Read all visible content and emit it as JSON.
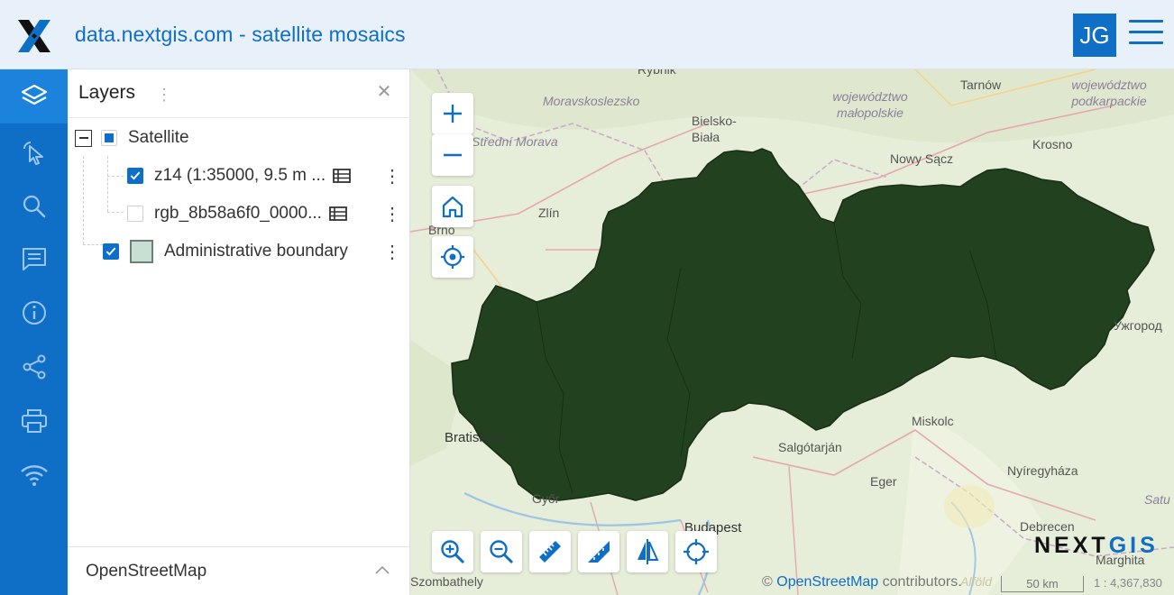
{
  "header": {
    "title": "data.nextgis.com - satellite mosaics",
    "avatar_initials": "JG"
  },
  "sidebar": {
    "items": [
      {
        "icon": "layers-icon",
        "active": true
      },
      {
        "icon": "identify-pointer-icon"
      },
      {
        "icon": "search-icon"
      },
      {
        "icon": "description-icon"
      },
      {
        "icon": "info-icon"
      },
      {
        "icon": "share-icon"
      },
      {
        "icon": "print-icon"
      },
      {
        "icon": "wifi-icon"
      }
    ]
  },
  "panel": {
    "title": "Layers",
    "tree": {
      "group": {
        "label": "Satellite",
        "state": "partial"
      },
      "children": [
        {
          "label": "z14 (1:35000, 9.5 m ...",
          "checked": true
        },
        {
          "label": "rgb_8b58a6f0_0000...",
          "checked": false
        }
      ],
      "admin": {
        "label": "Administrative boundary",
        "checked": true
      }
    },
    "basemap": {
      "label": "OpenStreetMap"
    }
  },
  "map": {
    "places": [
      {
        "name": "Rybnik",
        "kind": "city"
      },
      {
        "name": "Moravskoslezsko",
        "kind": "region"
      },
      {
        "name": "województwo małopolskie",
        "kind": "region"
      },
      {
        "name": "Tarnów",
        "kind": "city"
      },
      {
        "name": "województwo podkarpackie",
        "kind": "region"
      },
      {
        "name": "Bielsko-Biała",
        "kind": "city"
      },
      {
        "name": "Střední Morava",
        "kind": "region"
      },
      {
        "name": "Krosno",
        "kind": "city"
      },
      {
        "name": "Nowy Sącz",
        "kind": "city"
      },
      {
        "name": "Zlín",
        "kind": "city"
      },
      {
        "name": "Brno",
        "kind": "city"
      },
      {
        "name": "Bratislava",
        "kind": "city"
      },
      {
        "name": "Miskolc",
        "kind": "city"
      },
      {
        "name": "Salgótarján",
        "kind": "city"
      },
      {
        "name": "Nyíregyháza",
        "kind": "city"
      },
      {
        "name": "Eger",
        "kind": "city"
      },
      {
        "name": "Győr",
        "kind": "city"
      },
      {
        "name": "Budapest",
        "kind": "city"
      },
      {
        "name": "Debrecen",
        "kind": "city"
      },
      {
        "name": "Marghita",
        "kind": "city"
      },
      {
        "name": "Satu",
        "kind": "region"
      },
      {
        "name": "Szombathely",
        "kind": "city"
      },
      {
        "name": "Alföld",
        "kind": "region"
      },
      {
        "name": "Ужгород",
        "kind": "city"
      }
    ],
    "brand": "NEXTGIS",
    "attribution": {
      "prefix": "©",
      "link": "OpenStreetMap",
      "suffix": "contributors."
    },
    "scale_label": "50 km",
    "ratio": "1 : 4,367,830",
    "colors": {
      "accent": "#0f6ec5",
      "country_fill": "#22421f",
      "base": "#e9efdd"
    }
  }
}
